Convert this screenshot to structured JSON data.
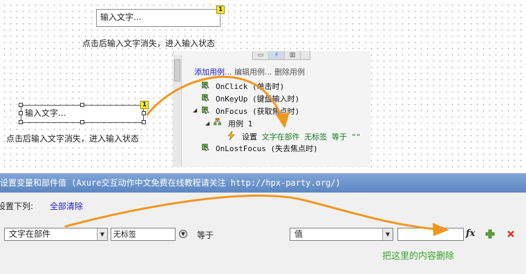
{
  "canvas": {
    "textbox_top": "输入文字...",
    "caption_top": "点击后输入文字消失，进入输入状态",
    "textbox_selected": "输入文字...",
    "caption_bottom": "点击后输入文字消失，进入输入状态",
    "note_marker_top": "1",
    "note_marker_selected": "1"
  },
  "case_panel": {
    "add_case": "添加用例",
    "edit_case": "编辑用例",
    "delete_case": "删除用例",
    "events": [
      {
        "label": "OnClick (单击时)"
      },
      {
        "label": "OnKeyUp (键盘输入时)"
      },
      {
        "label": "OnFocus (获取焦点时)"
      },
      {
        "label": "OnLostFocus (失去焦点时)"
      }
    ],
    "case_label": "用例 1",
    "action": {
      "verb": "设置",
      "detail": "文字在部件 无标签 等于 \"\""
    }
  },
  "dialog": {
    "title": "设置变量和部件值 (Axure交互动作中文免费在线教程请关注 http://hpx-party.org/)",
    "set_below_label": "设置下列:",
    "clear_all": "全部清除",
    "target_select": "文字在部件",
    "widget_name": "无标签",
    "equals_label": "等于",
    "value_select": "值",
    "value_input": "",
    "fx_icon": "fx"
  },
  "annotation": {
    "text": "把这里的内容删除"
  },
  "colors": {
    "arrow": "#f0961e",
    "title_bar": "#6b93cc",
    "annotation_text": "#3aa12b",
    "link": "#1a1acc"
  }
}
